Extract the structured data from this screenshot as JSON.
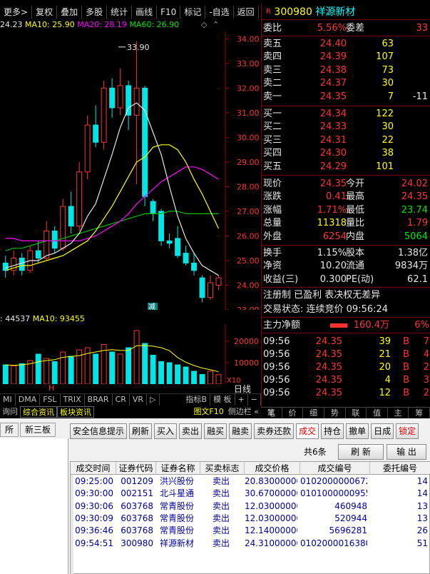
{
  "toolbar": {
    "items": [
      "更多>",
      "复权",
      "叠加",
      "多股",
      "统计",
      "画线",
      "F10",
      "标记",
      "-自选",
      "返回"
    ]
  },
  "ma_legend": {
    "ma5": "24.23",
    "ma10": "MA10: 25.90",
    "ma20": "MA20: 28.19",
    "ma60": "MA60: 26.90"
  },
  "price_axis": [
    "34.00",
    "33.00",
    "32.00",
    "31.00",
    "30.00",
    "29.00",
    "28.00",
    "27.00",
    "26.00",
    "25.00",
    "24.00",
    "23.00"
  ],
  "high_label": "33.90",
  "low_label": "23.16",
  "reduce_mark": "减",
  "vol_legend": {
    "vol": ": 44537",
    "ma10": "MA10: 93455"
  },
  "vol_axis": [
    "20000",
    "10000",
    "X10"
  ],
  "day_label": "日线",
  "marker_h": "H",
  "indicator_tabs": [
    "MI",
    "DMA",
    "FSL",
    "TRIX",
    "BRAR",
    "CR",
    "VR",
    "▷",
    "指标B",
    "模 板",
    "+",
    "−"
  ],
  "info_tabs": [
    "询问",
    "综合资讯",
    "板块资讯",
    "图文F10",
    "侧边栏 «"
  ],
  "stock": {
    "flag": "R",
    "code": "300980",
    "name": "祥源新材"
  },
  "order_ratio": {
    "label1": "委比",
    "val1": "5.56%",
    "label2": "委差",
    "val2": "33"
  },
  "asks": [
    {
      "label": "卖五",
      "price": "24.40",
      "vol": "63",
      "chg": ""
    },
    {
      "label": "卖四",
      "price": "24.39",
      "vol": "107",
      "chg": ""
    },
    {
      "label": "卖三",
      "price": "24.38",
      "vol": "73",
      "chg": ""
    },
    {
      "label": "卖二",
      "price": "24.37",
      "vol": "30",
      "chg": ""
    },
    {
      "label": "卖一",
      "price": "24.35",
      "vol": "7",
      "chg": "-11"
    }
  ],
  "bids": [
    {
      "label": "买一",
      "price": "24.34",
      "vol": "122"
    },
    {
      "label": "买二",
      "price": "24.33",
      "vol": "30"
    },
    {
      "label": "买三",
      "price": "24.31",
      "vol": "22"
    },
    {
      "label": "买四",
      "price": "24.30",
      "vol": "38"
    },
    {
      "label": "买五",
      "price": "24.29",
      "vol": "101"
    }
  ],
  "quote": [
    {
      "l1": "现价",
      "v1": "24.35",
      "c1": "red",
      "l2": "今开",
      "v2": "24.02",
      "c2": "red"
    },
    {
      "l1": "涨跌",
      "v1": "0.41",
      "c1": "red",
      "l2": "最高",
      "v2": "24.35",
      "c2": "red"
    },
    {
      "l1": "涨幅",
      "v1": "1.71%",
      "c1": "red",
      "l2": "最低",
      "v2": "23.74",
      "c2": "grn"
    },
    {
      "l1": "总量",
      "v1": "11318",
      "c1": "yel",
      "l2": "量比",
      "v2": "1.79",
      "c2": "red"
    },
    {
      "l1": "外盘",
      "v1": "6254",
      "c1": "red",
      "l2": "内盘",
      "v2": "5064",
      "c2": "grn"
    }
  ],
  "fund": [
    {
      "l1": "换手",
      "v1": "1.15%",
      "l2": "股本",
      "v2": "1.38亿"
    },
    {
      "l1": "净资",
      "v1": "10.20",
      "l2": "流通",
      "v2": "9834万"
    },
    {
      "l1": "收益(三)",
      "v1": "0.300",
      "l2": "PE(动)",
      "v2": "62.1"
    }
  ],
  "tags": "注册制 已盈利 表决权无差异",
  "trade_status": "交易状态: 连续竞价 09:56:24",
  "main_flow": {
    "label": "主力净额",
    "value": "160.4万",
    "pct": "6%"
  },
  "ticks": [
    {
      "time": "09:56",
      "price": "24.35",
      "vol": "39",
      "side": "B",
      "n": "7"
    },
    {
      "time": "09:56",
      "price": "24.35",
      "vol": "21",
      "side": "B",
      "n": "4"
    },
    {
      "time": "09:56",
      "price": "24.35",
      "vol": "20",
      "side": "B",
      "n": "2"
    },
    {
      "time": "09:56",
      "price": "24.35",
      "vol": "4",
      "side": "B",
      "n": "3"
    },
    {
      "time": "09:56",
      "price": "24.35",
      "vol": "12",
      "side": "B",
      "n": "2"
    }
  ],
  "right_tabs": [
    "笔",
    "价",
    "细",
    "势",
    "联",
    "值",
    "主",
    "筹"
  ],
  "left_tabs": [
    "所",
    "新三板"
  ],
  "buttons": [
    "安全信息提示",
    "刷新",
    "买入",
    "卖出",
    "融买",
    "融卖",
    "卖券还款",
    "成交",
    "持仓",
    "撤单",
    "日成",
    "锁定"
  ],
  "active_button": "成交",
  "count_label": "共6条",
  "refresh_label": "刷 新",
  "export_label": "输 出",
  "columns": [
    "成交时间",
    "证券代码",
    "证券名称",
    "买卖标志",
    "成交价格",
    "成交编号",
    "委托编号"
  ],
  "rows": [
    [
      "09:25:00",
      "001209",
      "洪兴股份",
      "卖出",
      "20.83000000",
      "0102000000672545",
      "14"
    ],
    [
      "09:30:00",
      "002151",
      "北斗星通",
      "卖出",
      "30.67000000",
      "0101000000955121",
      "14"
    ],
    [
      "09:30:06",
      "603768",
      "常青股份",
      "卖出",
      "12.03000000",
      "460948",
      "13"
    ],
    [
      "09:30:09",
      "603768",
      "常青股份",
      "卖出",
      "12.03000000",
      "520944",
      "13"
    ],
    [
      "09:36:46",
      "603768",
      "常青股份",
      "卖出",
      "12.14000000",
      "5696281",
      "26"
    ],
    [
      "09:54:51",
      "300980",
      "祥源新材",
      "卖出",
      "24.31000000",
      "0102000016380878",
      "51"
    ]
  ],
  "chart_data": {
    "type": "candlestick",
    "ylim": [
      23.0,
      34.3
    ],
    "candles": [
      [
        24.9,
        24.6,
        25.2,
        24.3
      ],
      [
        24.6,
        25.1,
        25.4,
        24.4
      ],
      [
        25.1,
        24.6,
        25.3,
        24.4
      ],
      [
        24.6,
        25.4,
        25.6,
        24.5
      ],
      [
        25.4,
        25.1,
        25.8,
        24.9
      ],
      [
        25.1,
        26.2,
        26.6,
        25.0
      ],
      [
        26.2,
        25.5,
        26.4,
        25.3
      ],
      [
        25.5,
        27.2,
        27.5,
        25.4
      ],
      [
        27.2,
        26.4,
        27.8,
        26.1
      ],
      [
        26.4,
        28.6,
        29.0,
        26.2
      ],
      [
        28.6,
        30.5,
        30.9,
        28.3
      ],
      [
        30.5,
        29.8,
        31.3,
        29.6
      ],
      [
        29.8,
        32.0,
        32.3,
        29.5
      ],
      [
        32.0,
        31.2,
        32.4,
        30.8
      ],
      [
        31.2,
        32.1,
        32.8,
        30.9
      ],
      [
        32.1,
        30.9,
        32.3,
        30.3
      ],
      [
        30.9,
        32.0,
        33.9,
        28.1
      ],
      [
        32.0,
        27.6,
        32.1,
        27.2
      ],
      [
        27.4,
        26.9,
        27.5,
        26.6
      ],
      [
        27.0,
        25.8,
        27.1,
        25.6
      ],
      [
        25.8,
        25.7,
        26.1,
        25.5
      ],
      [
        25.9,
        25.2,
        26.4,
        25.1
      ],
      [
        25.3,
        24.9,
        25.6,
        24.8
      ],
      [
        24.9,
        24.6,
        25.3,
        24.4
      ],
      [
        24.3,
        23.5,
        24.4,
        23.3
      ],
      [
        23.5,
        24.1,
        24.4,
        23.4
      ],
      [
        24.0,
        24.3,
        24.4,
        23.8
      ]
    ],
    "ma5": [
      24.7,
      24.8,
      24.9,
      25.0,
      25.0,
      25.2,
      25.3,
      25.5,
      25.7,
      26.1,
      26.8,
      27.3,
      28.3,
      29.3,
      30.4,
      31.2,
      31.4,
      31.1,
      30.2,
      29.3,
      28.0,
      26.8,
      25.9,
      25.3,
      24.8,
      24.6,
      24.4
    ],
    "ma10": [
      24.6,
      24.7,
      24.8,
      24.8,
      24.9,
      25.0,
      25.1,
      25.2,
      25.4,
      25.6,
      25.8,
      26.2,
      26.7,
      27.2,
      27.8,
      28.4,
      29.0,
      29.2,
      29.6,
      29.7,
      29.7,
      29.5,
      29.0,
      28.3,
      27.7,
      27.0,
      26.3
    ],
    "ma20": [
      25.9,
      25.9,
      25.8,
      25.8,
      25.8,
      25.8,
      25.8,
      25.8,
      25.8,
      25.8,
      25.9,
      26.0,
      26.2,
      26.4,
      26.6,
      26.9,
      27.3,
      27.6,
      27.9,
      28.2,
      28.4,
      28.6,
      28.8,
      28.8,
      28.7,
      28.5,
      28.3
    ],
    "ma60": [
      25.4,
      25.5,
      25.5,
      25.6,
      25.7,
      25.8,
      25.8,
      25.9,
      26.0,
      26.1,
      26.2,
      26.3,
      26.4,
      26.5,
      26.6,
      26.7,
      26.8,
      26.9,
      26.9,
      26.9,
      27.0,
      27.0,
      26.9,
      26.9,
      26.9,
      26.9,
      26.9
    ],
    "volume": [
      9000,
      8500,
      9500,
      11000,
      14000,
      12000,
      10500,
      15000,
      13000,
      16000,
      17000,
      14000,
      18500,
      15000,
      14000,
      17000,
      25000,
      19000,
      13500,
      10500,
      10000,
      9000,
      8000,
      6000,
      4500,
      6000,
      4400
    ],
    "volume_ylim": [
      0,
      28000
    ]
  }
}
